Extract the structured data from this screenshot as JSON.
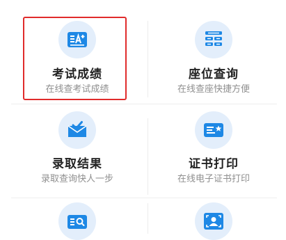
{
  "items": [
    {
      "title": "考试成绩",
      "subtitle": "在线查考试成绩",
      "icon": "exam-score-icon"
    },
    {
      "title": "座位查询",
      "subtitle": "在线查座快捷方便",
      "icon": "seat-query-icon"
    },
    {
      "title": "录取结果",
      "subtitle": "录取查询快人一步",
      "icon": "admission-mail-icon"
    },
    {
      "title": "证书打印",
      "subtitle": "在线电子证书打印",
      "icon": "certificate-print-icon"
    },
    {
      "title": "",
      "subtitle": "",
      "icon": "search-document-icon"
    },
    {
      "title": "",
      "subtitle": "",
      "icon": "face-id-icon"
    }
  ],
  "colors": {
    "accent": "#1e88e5",
    "icon_bg": "#e3eefb",
    "highlight": "#e02b2b",
    "title": "#222222",
    "subtitle": "#8f8f8f"
  }
}
